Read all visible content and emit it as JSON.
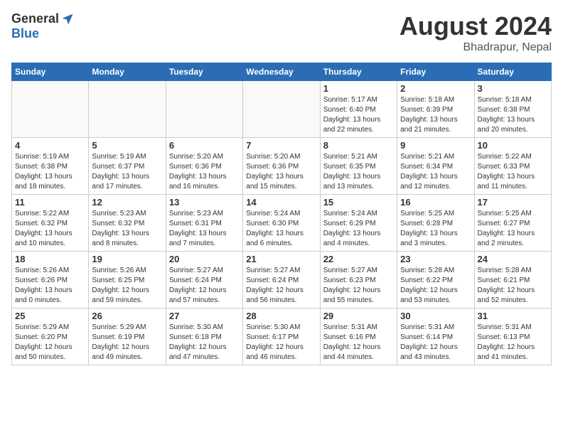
{
  "header": {
    "logo_general": "General",
    "logo_blue": "Blue",
    "month_year": "August 2024",
    "location": "Bhadrapur, Nepal"
  },
  "weekdays": [
    "Sunday",
    "Monday",
    "Tuesday",
    "Wednesday",
    "Thursday",
    "Friday",
    "Saturday"
  ],
  "weeks": [
    [
      {
        "day": "",
        "info": ""
      },
      {
        "day": "",
        "info": ""
      },
      {
        "day": "",
        "info": ""
      },
      {
        "day": "",
        "info": ""
      },
      {
        "day": "1",
        "info": "Sunrise: 5:17 AM\nSunset: 6:40 PM\nDaylight: 13 hours\nand 22 minutes."
      },
      {
        "day": "2",
        "info": "Sunrise: 5:18 AM\nSunset: 6:39 PM\nDaylight: 13 hours\nand 21 minutes."
      },
      {
        "day": "3",
        "info": "Sunrise: 5:18 AM\nSunset: 6:38 PM\nDaylight: 13 hours\nand 20 minutes."
      }
    ],
    [
      {
        "day": "4",
        "info": "Sunrise: 5:19 AM\nSunset: 6:38 PM\nDaylight: 13 hours\nand 18 minutes."
      },
      {
        "day": "5",
        "info": "Sunrise: 5:19 AM\nSunset: 6:37 PM\nDaylight: 13 hours\nand 17 minutes."
      },
      {
        "day": "6",
        "info": "Sunrise: 5:20 AM\nSunset: 6:36 PM\nDaylight: 13 hours\nand 16 minutes."
      },
      {
        "day": "7",
        "info": "Sunrise: 5:20 AM\nSunset: 6:36 PM\nDaylight: 13 hours\nand 15 minutes."
      },
      {
        "day": "8",
        "info": "Sunrise: 5:21 AM\nSunset: 6:35 PM\nDaylight: 13 hours\nand 13 minutes."
      },
      {
        "day": "9",
        "info": "Sunrise: 5:21 AM\nSunset: 6:34 PM\nDaylight: 13 hours\nand 12 minutes."
      },
      {
        "day": "10",
        "info": "Sunrise: 5:22 AM\nSunset: 6:33 PM\nDaylight: 13 hours\nand 11 minutes."
      }
    ],
    [
      {
        "day": "11",
        "info": "Sunrise: 5:22 AM\nSunset: 6:32 PM\nDaylight: 13 hours\nand 10 minutes."
      },
      {
        "day": "12",
        "info": "Sunrise: 5:23 AM\nSunset: 6:32 PM\nDaylight: 13 hours\nand 8 minutes."
      },
      {
        "day": "13",
        "info": "Sunrise: 5:23 AM\nSunset: 6:31 PM\nDaylight: 13 hours\nand 7 minutes."
      },
      {
        "day": "14",
        "info": "Sunrise: 5:24 AM\nSunset: 6:30 PM\nDaylight: 13 hours\nand 6 minutes."
      },
      {
        "day": "15",
        "info": "Sunrise: 5:24 AM\nSunset: 6:29 PM\nDaylight: 13 hours\nand 4 minutes."
      },
      {
        "day": "16",
        "info": "Sunrise: 5:25 AM\nSunset: 6:28 PM\nDaylight: 13 hours\nand 3 minutes."
      },
      {
        "day": "17",
        "info": "Sunrise: 5:25 AM\nSunset: 6:27 PM\nDaylight: 13 hours\nand 2 minutes."
      }
    ],
    [
      {
        "day": "18",
        "info": "Sunrise: 5:26 AM\nSunset: 6:26 PM\nDaylight: 13 hours\nand 0 minutes."
      },
      {
        "day": "19",
        "info": "Sunrise: 5:26 AM\nSunset: 6:25 PM\nDaylight: 12 hours\nand 59 minutes."
      },
      {
        "day": "20",
        "info": "Sunrise: 5:27 AM\nSunset: 6:24 PM\nDaylight: 12 hours\nand 57 minutes."
      },
      {
        "day": "21",
        "info": "Sunrise: 5:27 AM\nSunset: 6:24 PM\nDaylight: 12 hours\nand 56 minutes."
      },
      {
        "day": "22",
        "info": "Sunrise: 5:27 AM\nSunset: 6:23 PM\nDaylight: 12 hours\nand 55 minutes."
      },
      {
        "day": "23",
        "info": "Sunrise: 5:28 AM\nSunset: 6:22 PM\nDaylight: 12 hours\nand 53 minutes."
      },
      {
        "day": "24",
        "info": "Sunrise: 5:28 AM\nSunset: 6:21 PM\nDaylight: 12 hours\nand 52 minutes."
      }
    ],
    [
      {
        "day": "25",
        "info": "Sunrise: 5:29 AM\nSunset: 6:20 PM\nDaylight: 12 hours\nand 50 minutes."
      },
      {
        "day": "26",
        "info": "Sunrise: 5:29 AM\nSunset: 6:19 PM\nDaylight: 12 hours\nand 49 minutes."
      },
      {
        "day": "27",
        "info": "Sunrise: 5:30 AM\nSunset: 6:18 PM\nDaylight: 12 hours\nand 47 minutes."
      },
      {
        "day": "28",
        "info": "Sunrise: 5:30 AM\nSunset: 6:17 PM\nDaylight: 12 hours\nand 46 minutes."
      },
      {
        "day": "29",
        "info": "Sunrise: 5:31 AM\nSunset: 6:16 PM\nDaylight: 12 hours\nand 44 minutes."
      },
      {
        "day": "30",
        "info": "Sunrise: 5:31 AM\nSunset: 6:14 PM\nDaylight: 12 hours\nand 43 minutes."
      },
      {
        "day": "31",
        "info": "Sunrise: 5:31 AM\nSunset: 6:13 PM\nDaylight: 12 hours\nand 41 minutes."
      }
    ]
  ]
}
